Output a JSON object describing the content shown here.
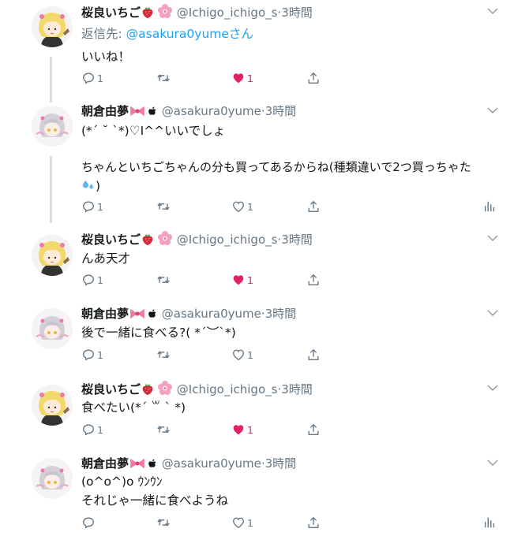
{
  "colors": {
    "accent": "#1da1f2",
    "muted": "#657786",
    "like": "#e0245e",
    "thread": "#d5dce3"
  },
  "tweets": [
    {
      "name": "桜良いちご",
      "handle": "@Ichigo_ichigo_s",
      "sep": "·",
      "time": "3時間",
      "reply_prefix": "返信先: ",
      "reply_to": "@asakura0yumeさん",
      "lines": [
        "いいね！"
      ],
      "reply_count": "1",
      "like_count": "1",
      "liked": true
    },
    {
      "name": "朝倉由夢",
      "handle": "@asakura0yume",
      "sep": "·",
      "time": "3時間",
      "lines": [
        "(*´ ˘ `*)♡I^^いいでしょ",
        "",
        "ちゃんといちごちゃんの分も買ってあるからね(種類違いで2つ買っちゃた"
      ],
      "line4_end": ")",
      "reply_count": "1",
      "like_count": "1",
      "liked": false
    },
    {
      "name": "桜良いちご",
      "handle": "@Ichigo_ichigo_s",
      "sep": "·",
      "time": "3時間",
      "lines": [
        "んあ天才"
      ],
      "reply_count": "1",
      "like_count": "1",
      "liked": true
    },
    {
      "name": "朝倉由夢",
      "handle": "@asakura0yume",
      "sep": "·",
      "time": "3時間",
      "lines": [
        "後で一緒に食べる?( *´︶`*)"
      ],
      "reply_count": "1",
      "like_count": "1",
      "liked": false
    },
    {
      "name": "桜良いちご",
      "handle": "@Ichigo_ichigo_s",
      "sep": "·",
      "time": "3時間",
      "lines": [
        "食べたい(*´ ꒳ ` *)"
      ],
      "reply_count": "1",
      "like_count": "1",
      "liked": true
    },
    {
      "name": "朝倉由夢",
      "handle": "@asakura0yume",
      "sep": "·",
      "time": "3時間",
      "lines": [
        "(o^o^)o ｳﾝｳﾝ",
        "それじゃ一緒に食べようね"
      ],
      "reply_count": "",
      "like_count": "1",
      "liked": false
    }
  ],
  "icons": [
    "reply-icon",
    "retweet-icon",
    "like-icon",
    "share-icon",
    "analytics-icon",
    "chevron-down-icon",
    "strawberry-icon",
    "flower-icon",
    "ribbon-icon",
    "apple-icon",
    "sweat-drops-icon"
  ]
}
